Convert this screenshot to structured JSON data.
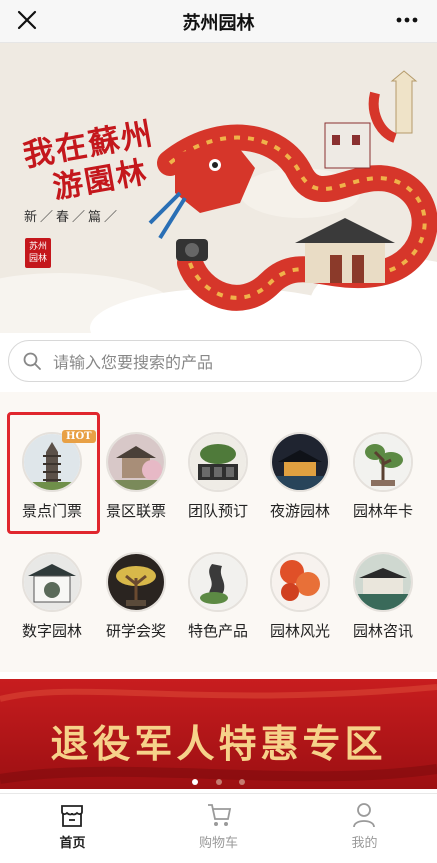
{
  "header": {
    "title": "苏州园林"
  },
  "banner": {
    "line1": "我在蘇州",
    "line2": "游園林",
    "sub": "新／春／篇／",
    "seal": "苏州园林"
  },
  "search": {
    "placeholder": "请输入您要搜索的产品",
    "value": ""
  },
  "categories": [
    {
      "label": "景点门票",
      "badge": "HOT",
      "icon": "pagoda-icon"
    },
    {
      "label": "景区联票",
      "icon": "pavilion-icon"
    },
    {
      "label": "团队预订",
      "icon": "bonsai-icon"
    },
    {
      "label": "夜游园林",
      "icon": "night-garden-icon"
    },
    {
      "label": "园林年卡",
      "icon": "tree-icon"
    },
    {
      "label": "数字园林",
      "icon": "gate-icon"
    },
    {
      "label": "研学会奖",
      "icon": "study-bonsai-icon"
    },
    {
      "label": "特色产品",
      "icon": "rock-icon"
    },
    {
      "label": "园林风光",
      "icon": "maple-icon"
    },
    {
      "label": "园林咨讯",
      "icon": "news-icon"
    }
  ],
  "promo": {
    "text": "退役军人特惠专区"
  },
  "carousel": {
    "total": 3,
    "active": 0
  },
  "tabbar": [
    {
      "label": "首页",
      "icon": "shop-icon",
      "active": true
    },
    {
      "label": "购物车",
      "icon": "cart-icon",
      "active": false
    },
    {
      "label": "我的",
      "icon": "user-icon",
      "active": false
    }
  ],
  "colors": {
    "brand_red": "#c4171c",
    "highlight": "#e0262d",
    "gold": "#f6d28a"
  }
}
